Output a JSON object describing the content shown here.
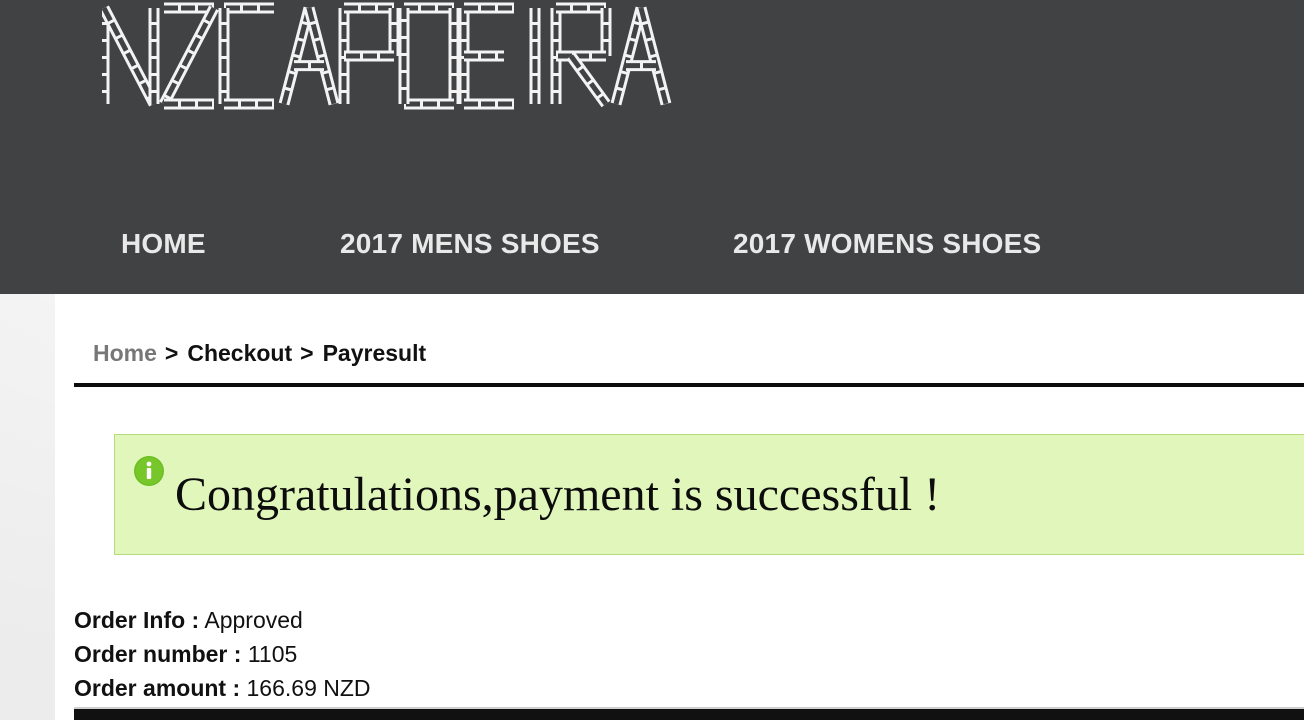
{
  "site": {
    "logo_text": "NZCAPOEIRA"
  },
  "nav": {
    "items": [
      {
        "label": "HOME"
      },
      {
        "label": "2017 MENS SHOES"
      },
      {
        "label": "2017 WOMENS SHOES"
      }
    ]
  },
  "breadcrumb": {
    "items": [
      {
        "label": "Home"
      },
      {
        "label": "Checkout"
      },
      {
        "label": "Payresult"
      }
    ],
    "separator": ">"
  },
  "notice": {
    "icon": "info-icon",
    "message": "Congratulations,payment is successful !",
    "background_color": "#e0f6bb",
    "icon_color": "#6cbf22"
  },
  "order": {
    "info_label": "Order Info :",
    "info_value": "Approved",
    "number_label": "Order number :",
    "number_value": "1105",
    "amount_label": "Order amount :",
    "amount_value": "166.69 NZD"
  },
  "colors": {
    "header_bg": "#414244",
    "nav_text": "#e9e9e9",
    "breadcrumb_link": "#777777"
  }
}
